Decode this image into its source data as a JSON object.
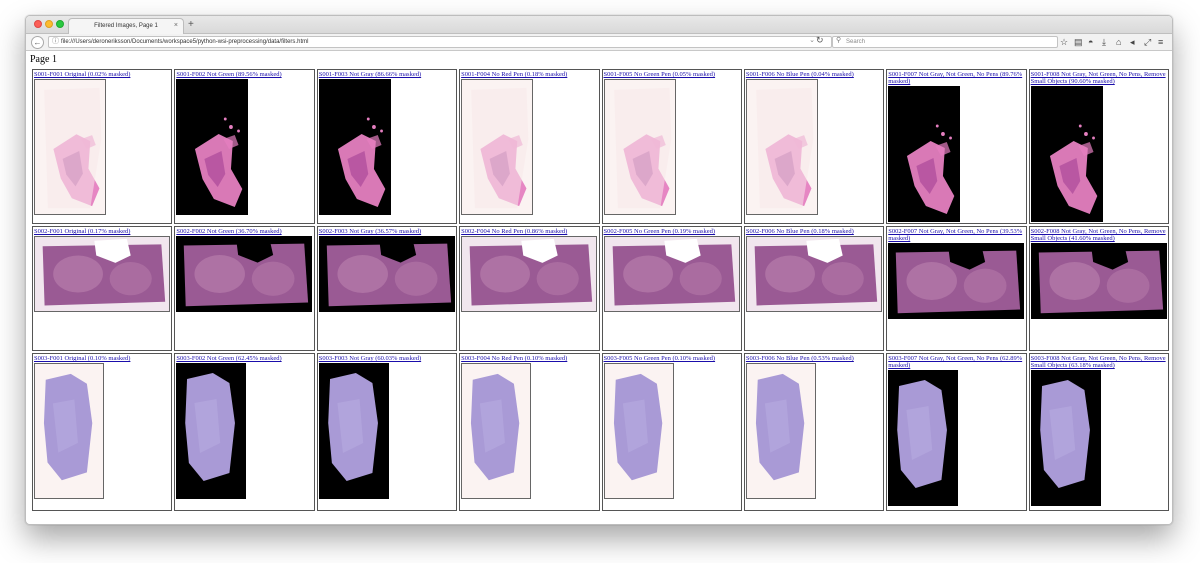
{
  "browser": {
    "tab_title": "Filtered Images, Page 1",
    "tab_close": "×",
    "new_tab": "+",
    "url": "file:///Users/deroneriksson/Documents/workspace5/python-wsi-preprocessing/data/filters.html",
    "search_placeholder": "Search",
    "back_glyph": "←",
    "info_glyph": "ⓘ",
    "dropdown_glyph": "⌄",
    "reload_glyph": "↻",
    "search_glyph": "⚲",
    "toolbar_icons": [
      "star-icon",
      "clipboard-icon",
      "pocket-icon",
      "download-icon",
      "home-icon",
      "share-icon",
      "tools-icon",
      "menu-icon"
    ],
    "toolbar_glyphs": [
      "☆",
      "▤",
      "◓",
      "⤓",
      "⌂",
      "◂",
      "⤢",
      "≡"
    ]
  },
  "page": {
    "heading": "Page 1",
    "link_color": "#1a0dab"
  },
  "rows": [
    {
      "slide": "S001",
      "cells": [
        {
          "label": "S001-F001 Original (0.02% masked)",
          "bg": "white",
          "stain": "pink"
        },
        {
          "label": "S001-F002 Not Green (89.56% masked)",
          "bg": "black",
          "stain": "pink"
        },
        {
          "label": "S001-F003 Not Gray (86.66% masked)",
          "bg": "black",
          "stain": "pink"
        },
        {
          "label": "S001-F004 No Red Pen (0.18% masked)",
          "bg": "white",
          "stain": "pink"
        },
        {
          "label": "S001-F005 No Green Pen (0.05% masked)",
          "bg": "white",
          "stain": "pink"
        },
        {
          "label": "S001-F006 No Blue Pen (0.04% masked)",
          "bg": "white",
          "stain": "pink"
        },
        {
          "label": "S001-F007 Not Gray, Not Green, No Pens (89.76% masked)",
          "bg": "black",
          "stain": "pink"
        },
        {
          "label": "S001-F008 Not Gray, Not Green, No Pens, Remove Small Objects (90.60% masked)",
          "bg": "black",
          "stain": "pink"
        }
      ]
    },
    {
      "slide": "S002",
      "cells": [
        {
          "label": "S002-F001 Original (0.17% masked)",
          "bg": "white",
          "stain": "purple"
        },
        {
          "label": "S002-F002 Not Green (36.70% masked)",
          "bg": "black",
          "stain": "purple"
        },
        {
          "label": "S002-F003 Not Gray (36.57% masked)",
          "bg": "black",
          "stain": "purple"
        },
        {
          "label": "S002-F004 No Red Pen (0.86% masked)",
          "bg": "white",
          "stain": "purple"
        },
        {
          "label": "S002-F005 No Green Pen (0.19% masked)",
          "bg": "white",
          "stain": "purple"
        },
        {
          "label": "S002-F006 No Blue Pen (0.18% masked)",
          "bg": "white",
          "stain": "purple"
        },
        {
          "label": "S002-F007 Not Gray, Not Green, No Pens (39.53% masked)",
          "bg": "black",
          "stain": "purple"
        },
        {
          "label": "S002-F008 Not Gray, Not Green, No Pens, Remove Small Objects (41.60% masked)",
          "bg": "black",
          "stain": "purple"
        }
      ]
    },
    {
      "slide": "S003",
      "cells": [
        {
          "label": "S003-F001 Original (0.10% masked)",
          "bg": "white",
          "stain": "lavender"
        },
        {
          "label": "S003-F002 Not Green (62.45% masked)",
          "bg": "black",
          "stain": "lavender"
        },
        {
          "label": "S003-F003 Not Gray (60.03% masked)",
          "bg": "black",
          "stain": "lavender"
        },
        {
          "label": "S003-F004 No Red Pen (0.10% masked)",
          "bg": "white",
          "stain": "lavender"
        },
        {
          "label": "S003-F005 No Green Pen (0.10% masked)",
          "bg": "white",
          "stain": "lavender"
        },
        {
          "label": "S003-F006 No Blue Pen (0.53% masked)",
          "bg": "white",
          "stain": "lavender"
        },
        {
          "label": "S003-F007 Not Gray, Not Green, No Pens (62.89% masked)",
          "bg": "black",
          "stain": "lavender"
        },
        {
          "label": "S003-F008 Not Gray, Not Green, No Pens, Remove Small Objects (63.18% masked)",
          "bg": "black",
          "stain": "lavender"
        }
      ]
    }
  ],
  "colors": {
    "pink_tissue": "#e57fc0",
    "pink_dark": "#b04f9e",
    "purple_tissue": "#9a5a94",
    "purple_light": "#c890b8",
    "lavender_tissue": "#a99ad6",
    "white_bg": "#fbf3f2",
    "mask_black": "#000000"
  }
}
